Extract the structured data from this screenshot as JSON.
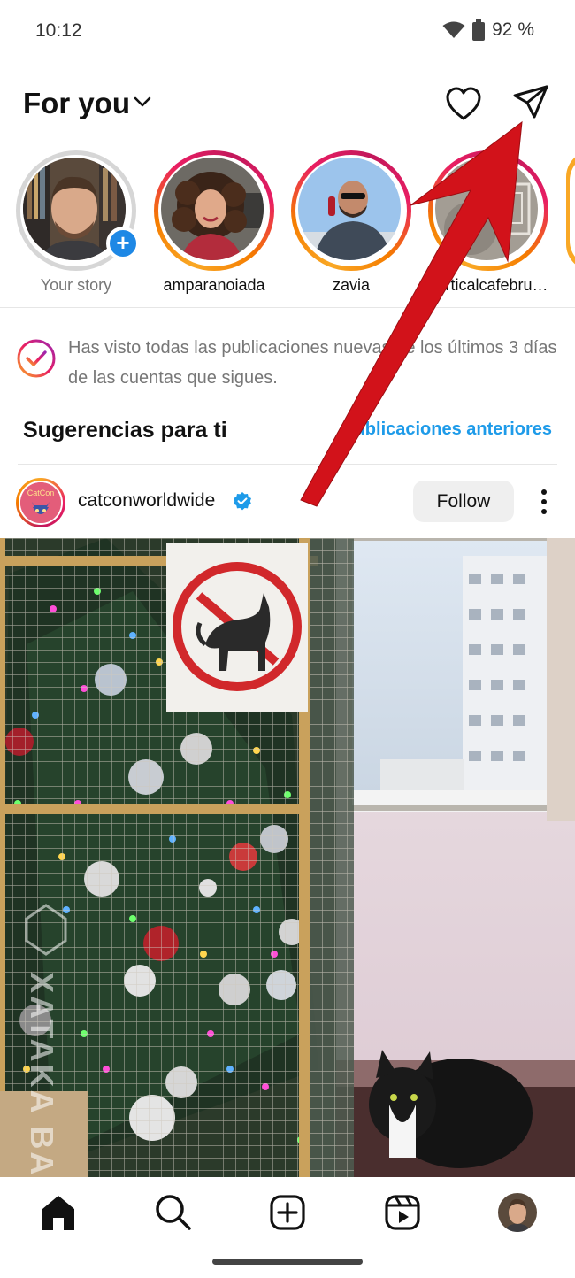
{
  "status_bar": {
    "time": "10:12",
    "battery": "92 %"
  },
  "header": {
    "title": "For you"
  },
  "stories": [
    {
      "label": "Your story",
      "seen": true,
      "own": true
    },
    {
      "label": "amparanoiada",
      "seen": false
    },
    {
      "label": "zavia",
      "seen": false
    },
    {
      "label": "verticalcafebru…",
      "seen": false
    }
  ],
  "caught_up": {
    "text": "Has visto todas las publicaciones nuevas de los últimos 3 días de las cuentas que sigues."
  },
  "suggestions": {
    "title": "Sugerencias para ti",
    "link": "Publicaciones anteriores"
  },
  "post": {
    "username": "catconworldwide",
    "avatar_text": "CatCon",
    "follow_label": "Follow",
    "watermark": "XATAKA BASICS"
  },
  "bottom_nav": {
    "items": [
      "home-icon",
      "search-icon",
      "create-icon",
      "reels-icon",
      "profile-avatar"
    ]
  },
  "colors": {
    "accent_blue": "#1e9be9",
    "arrow_red": "#d2121a"
  }
}
